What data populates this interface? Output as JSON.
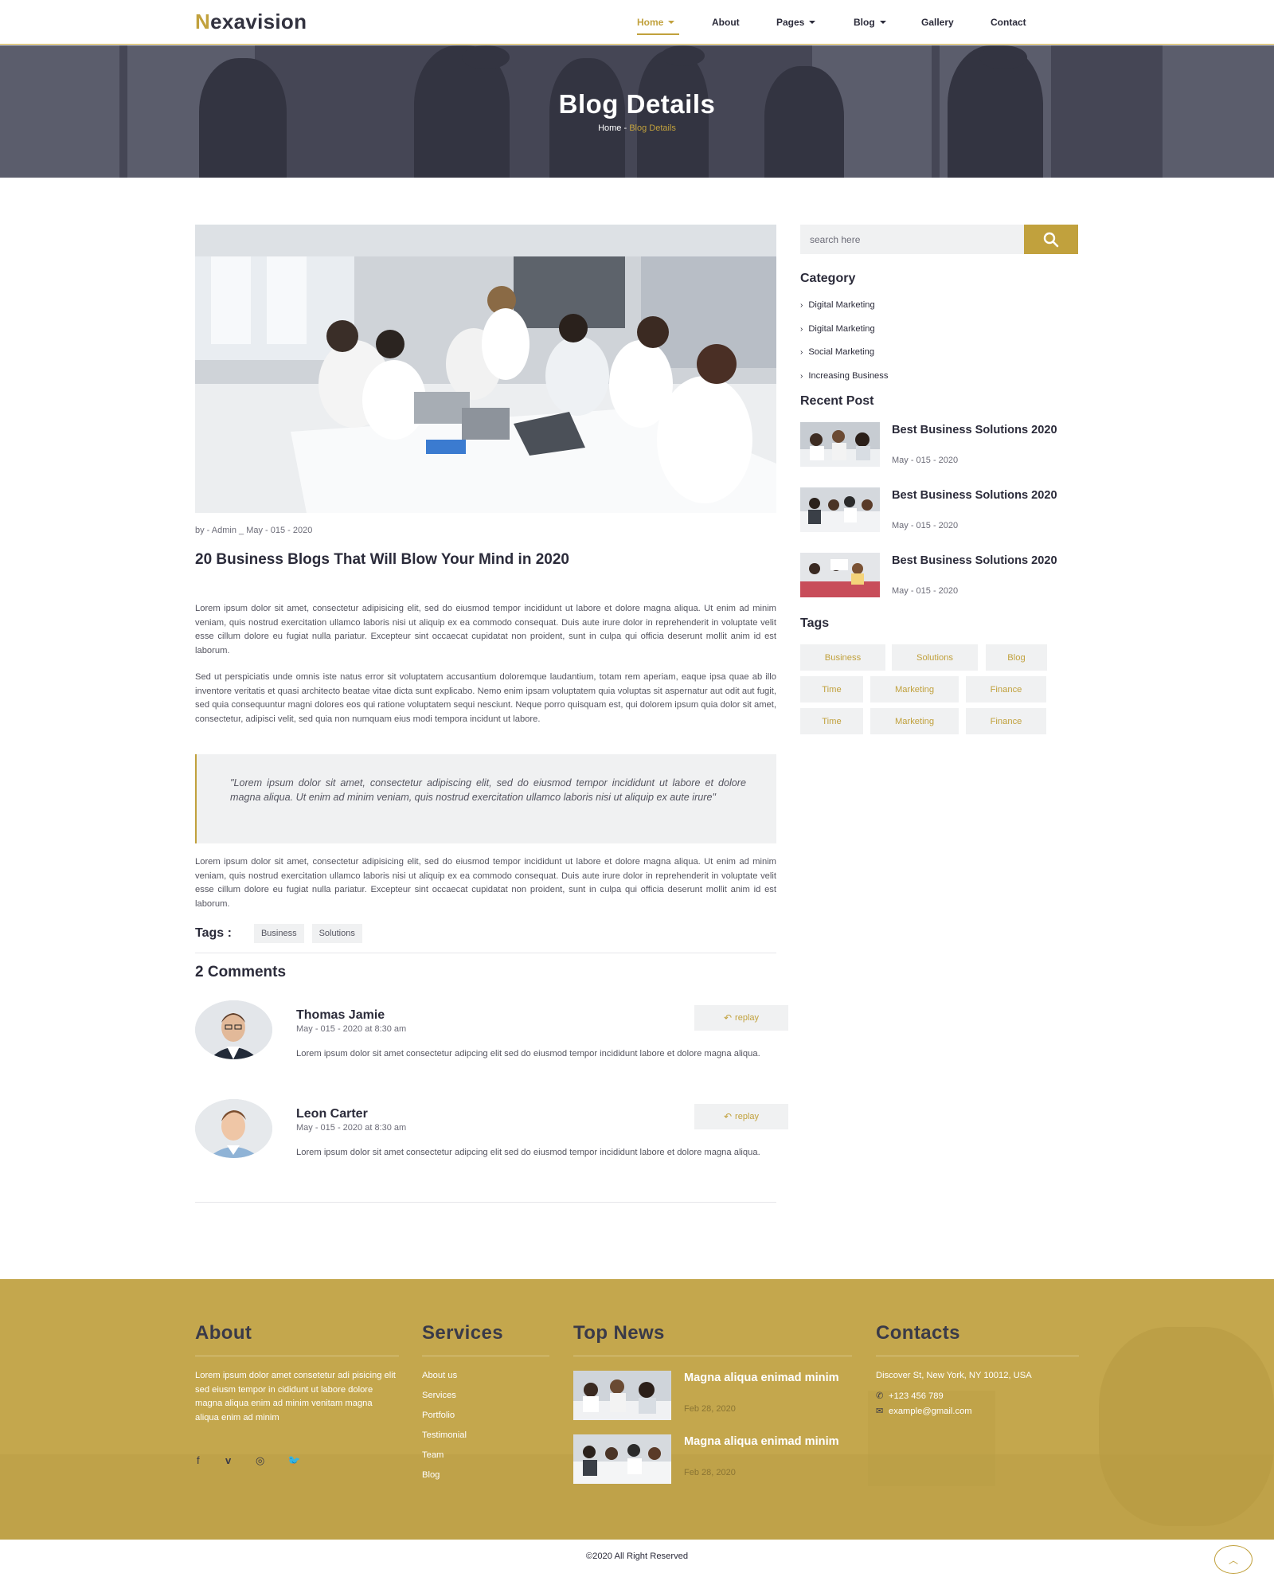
{
  "brand": {
    "first_letter": "N",
    "rest": "exavision",
    "accent": "#c1a13d"
  },
  "nav": {
    "home": "Home",
    "about": "About",
    "pages": "Pages",
    "blog": "Blog",
    "gallery": "Gallery",
    "contact": "Contact"
  },
  "hero": {
    "title": "Blog Details",
    "crumb_home": "Home",
    "crumb_sep": " - ",
    "crumb_current": "Blog Details"
  },
  "article": {
    "meta": "by - Admin _ May - 015 - 2020",
    "title": "20 Business Blogs That Will Blow Your Mind in 2020",
    "para1": "Lorem ipsum dolor sit amet, consectetur adipisicing elit, sed do eiusmod tempor incididunt ut labore et dolore magna aliqua. Ut enim ad minim veniam, quis nostrud exercitation ullamco laboris nisi ut aliquip ex ea commodo consequat. Duis aute irure dolor in reprehenderit in voluptate velit esse cillum dolore eu fugiat nulla pariatur. Excepteur sint occaecat cupidatat non proident, sunt in culpa qui officia deserunt mollit anim id est laborum.",
    "para2": "Sed ut perspiciatis unde omnis iste natus error sit voluptatem accusantium doloremque laudantium, totam rem aperiam, eaque ipsa quae ab illo inventore veritatis et quasi architecto beatae vitae dicta sunt explicabo. Nemo enim ipsam voluptatem quia voluptas sit aspernatur aut odit aut fugit, sed quia consequuntur magni dolores eos qui ratione voluptatem sequi nesciunt. Neque porro quisquam est, qui dolorem ipsum quia dolor sit amet, consectetur, adipisci velit, sed quia non numquam eius modi tempora incidunt ut labore.",
    "quote": "\"Lorem ipsum dolor sit amet, consectetur adipiscing elit, sed do eiusmod tempor incididunt ut labore et dolore magna aliqua. Ut enim ad minim veniam, quis nostrud exercitation ullamco laboris nisi ut aliquip ex aute irure\"",
    "para3": "Lorem ipsum dolor sit amet, consectetur adipisicing elit, sed do eiusmod tempor incididunt ut labore et dolore magna aliqua. Ut enim ad minim veniam, quis nostrud exercitation ullamco laboris nisi ut aliquip ex ea commodo consequat. Duis aute irure dolor in reprehenderit in voluptate velit esse cillum dolore eu fugiat nulla pariatur. Excepteur sint occaecat cupidatat non proident, sunt in culpa qui officia deserunt mollit anim id est laborum.",
    "tags_label": "Tags :",
    "tags": [
      "Business",
      "Solutions"
    ]
  },
  "comments": {
    "title": "2 Comments",
    "items": [
      {
        "name": "Thomas Jamie",
        "date": "May - 015 - 2020 at 8:30 am",
        "text": "Lorem ipsum dolor sit amet consectetur adipcing elit sed do eiusmod tempor incididunt labore et dolore magna aliqua.",
        "reply": "replay"
      },
      {
        "name": "Leon Carter",
        "date": "May - 015 - 2020 at 8:30 am",
        "text": "Lorem ipsum dolor sit amet consectetur adipcing elit sed do eiusmod tempor incididunt labore et dolore magna aliqua.",
        "reply": "replay"
      }
    ]
  },
  "sidebar": {
    "search_placeholder": "search here",
    "category_title": "Category",
    "categories": [
      "Digital Marketing",
      "Digital Marketing",
      "Social Marketing",
      "Increasing Business"
    ],
    "recent_title": "Recent Post",
    "recent": [
      {
        "title": "Best Business Solutions 2020",
        "date": "May - 015 - 2020"
      },
      {
        "title": "Best Business Solutions 2020",
        "date": "May - 015 - 2020"
      },
      {
        "title": "Best Business Solutions 2020",
        "date": "May - 015 - 2020"
      }
    ],
    "tags_title": "Tags",
    "tags": [
      "Business",
      "Solutions",
      "Blog",
      "Time",
      "Marketing",
      "Finance",
      "Time",
      "Marketing",
      "Finance"
    ]
  },
  "footer": {
    "about_title": "About",
    "about_text": "Lorem ipsum dolor amet consetetur adi pisicing elit sed eiusm tempor in cididunt ut labore dolore magna aliqua enim ad minim venitam magna aliqua enim ad minim",
    "social": [
      "facebook-icon",
      "vimeo-icon",
      "instagram-icon",
      "twitter-icon"
    ],
    "services_title": "Services",
    "services": [
      "About us",
      "Services",
      "Portfolio",
      "Testimonial",
      "Team",
      "Blog"
    ],
    "news_title": "Top News",
    "news": [
      {
        "title": "Magna aliqua enimad minim",
        "date": "Feb 28, 2020"
      },
      {
        "title": "Magna aliqua enimad minim",
        "date": "Feb 28, 2020"
      }
    ],
    "contacts_title": "Contacts",
    "address": "Discover St, New York, NY 10012, USA",
    "phone": "+123 456 789",
    "email": "example@gmail.com",
    "copyright": "©2020 All Right Reserved"
  }
}
